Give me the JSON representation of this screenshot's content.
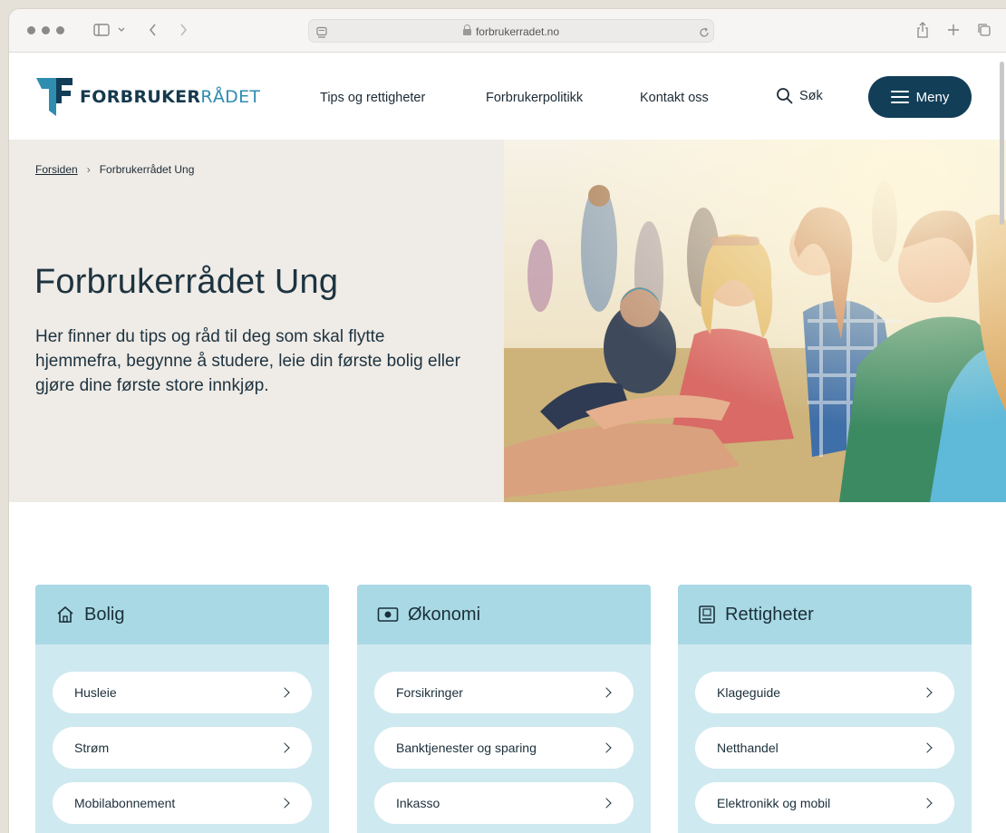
{
  "browser": {
    "url": "forbrukerradet.no"
  },
  "header": {
    "logo_bold": "FORBRUKER",
    "logo_thin": "RÅDET",
    "nav": [
      "Tips og rettigheter",
      "Forbrukerpolitikk",
      "Kontakt oss"
    ],
    "search_label": "Søk",
    "menu_label": "Meny",
    "brand_color": "#123e58"
  },
  "hero": {
    "breadcrumb": {
      "home": "Forsiden",
      "current": "Forbrukerrådet Ung"
    },
    "title": "Forbrukerrådet Ung",
    "text": "Her finner du tips og råd til deg som skal flytte hjemmefra, begynne å studere, leie din første bolig eller gjøre dine første store innkjøp.",
    "background": "#efebe6"
  },
  "cards": [
    {
      "title": "Bolig",
      "icon": "house-icon",
      "items": [
        "Husleie",
        "Strøm",
        "Mobilabonnement"
      ]
    },
    {
      "title": "Økonomi",
      "icon": "banknote-icon",
      "items": [
        "Forsikringer",
        "Banktjenester og sparing",
        "Inkasso"
      ]
    },
    {
      "title": "Rettigheter",
      "icon": "law-book-icon",
      "items": [
        "Klageguide",
        "Netthandel",
        "Elektronikk og mobil"
      ]
    }
  ],
  "colors": {
    "card_head": "#a9d9e5",
    "card_body": "#cfe9f0"
  }
}
